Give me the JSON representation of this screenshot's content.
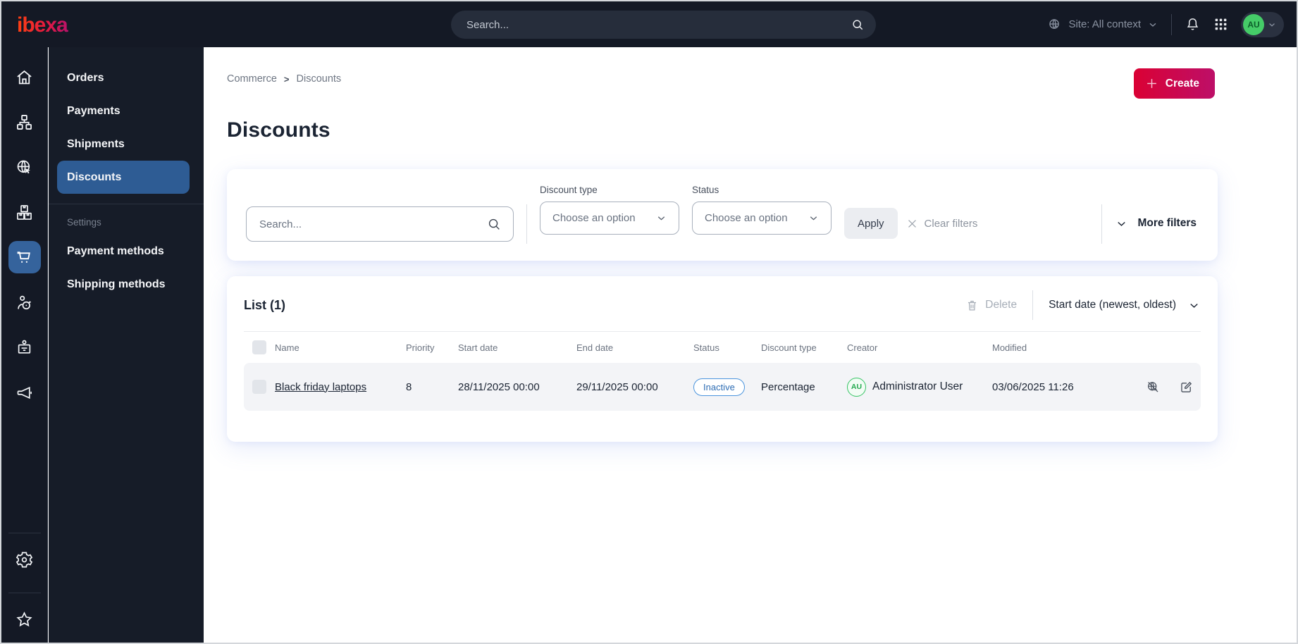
{
  "colors": {
    "chrome_bg": "#141925",
    "menu_bg": "#161c28",
    "active_blue": "#35639c",
    "active_menu_blue": "#2e5c94",
    "create_gradient_start": "#da0134",
    "create_gradient_end": "#bd0f68",
    "logo_gradient": [
      "#ff4112",
      "#e61a3f",
      "#b8126b"
    ],
    "badge_inactive_border": "#4b94dd",
    "badge_inactive_text": "#2e6db4",
    "avatar_green": "#45cc68",
    "row_bg": "#f3f4f7"
  },
  "topbar": {
    "logo": "ibexa",
    "search_placeholder": "Search...",
    "site_context": "Site: All context",
    "avatar_initials": "AU",
    "icons": [
      "site-context-globe-icon",
      "chevron-down-icon",
      "notifications-bell-icon",
      "app-grid-icon",
      "search-icon"
    ]
  },
  "sidebar": {
    "items": [
      {
        "icon": "home-icon"
      },
      {
        "icon": "content-tree-icon"
      },
      {
        "icon": "site-globe-cursor-icon"
      },
      {
        "icon": "products-boxes-icon"
      },
      {
        "icon": "commerce-cart-icon",
        "active": true
      },
      {
        "icon": "customer-target-icon"
      },
      {
        "icon": "id-badge-icon"
      },
      {
        "icon": "megaphone-icon"
      }
    ],
    "bottom_items": [
      {
        "icon": "gear-icon"
      },
      {
        "icon": "star-icon"
      }
    ]
  },
  "menu": {
    "items": [
      {
        "label": "Orders"
      },
      {
        "label": "Payments"
      },
      {
        "label": "Shipments"
      },
      {
        "label": "Discounts",
        "active": true
      }
    ],
    "settings_label": "Settings",
    "settings_items": [
      {
        "label": "Payment methods"
      },
      {
        "label": "Shipping methods"
      }
    ]
  },
  "breadcrumb": {
    "items": [
      "Commerce",
      "Discounts"
    ],
    "separator": ">"
  },
  "page": {
    "title": "Discounts",
    "create_label": "Create"
  },
  "filters": {
    "search_placeholder": "Search...",
    "discount_type_label": "Discount type",
    "discount_type_value": "Choose an option",
    "status_label": "Status",
    "status_value": "Choose an option",
    "apply_label": "Apply",
    "clear_label": "Clear filters",
    "more_label": "More filters"
  },
  "list": {
    "title": "List (1)",
    "delete_label": "Delete",
    "sort_label": "Start date (newest, oldest)",
    "columns": [
      "Name",
      "Priority",
      "Start date",
      "End date",
      "Status",
      "Discount type",
      "Creator",
      "Modified"
    ],
    "rows": [
      {
        "name": "Black friday laptops",
        "priority": "8",
        "start_date": "28/11/2025 00:00",
        "end_date": "29/11/2025 00:00",
        "status": "Inactive",
        "discount_type": "Percentage",
        "creator_initials": "AU",
        "creator": "Administrator User",
        "modified": "03/06/2025 11:26",
        "action_icons": [
          "preview-disabled-icon",
          "edit-icon"
        ]
      }
    ]
  }
}
